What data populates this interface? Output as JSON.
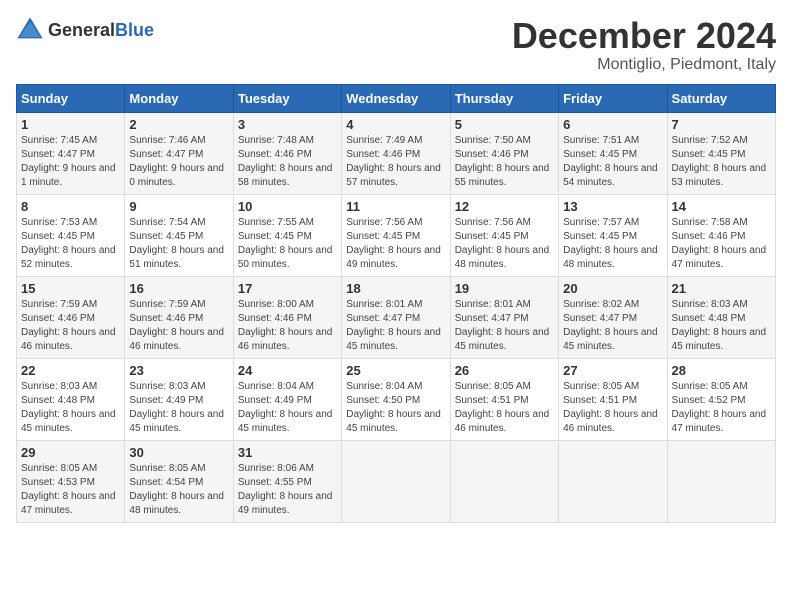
{
  "header": {
    "logo_general": "General",
    "logo_blue": "Blue",
    "month": "December 2024",
    "location": "Montiglio, Piedmont, Italy"
  },
  "days_of_week": [
    "Sunday",
    "Monday",
    "Tuesday",
    "Wednesday",
    "Thursday",
    "Friday",
    "Saturday"
  ],
  "weeks": [
    [
      {
        "day": "1",
        "sunrise": "Sunrise: 7:45 AM",
        "sunset": "Sunset: 4:47 PM",
        "daylight": "Daylight: 9 hours and 1 minute."
      },
      {
        "day": "2",
        "sunrise": "Sunrise: 7:46 AM",
        "sunset": "Sunset: 4:47 PM",
        "daylight": "Daylight: 9 hours and 0 minutes."
      },
      {
        "day": "3",
        "sunrise": "Sunrise: 7:48 AM",
        "sunset": "Sunset: 4:46 PM",
        "daylight": "Daylight: 8 hours and 58 minutes."
      },
      {
        "day": "4",
        "sunrise": "Sunrise: 7:49 AM",
        "sunset": "Sunset: 4:46 PM",
        "daylight": "Daylight: 8 hours and 57 minutes."
      },
      {
        "day": "5",
        "sunrise": "Sunrise: 7:50 AM",
        "sunset": "Sunset: 4:46 PM",
        "daylight": "Daylight: 8 hours and 55 minutes."
      },
      {
        "day": "6",
        "sunrise": "Sunrise: 7:51 AM",
        "sunset": "Sunset: 4:45 PM",
        "daylight": "Daylight: 8 hours and 54 minutes."
      },
      {
        "day": "7",
        "sunrise": "Sunrise: 7:52 AM",
        "sunset": "Sunset: 4:45 PM",
        "daylight": "Daylight: 8 hours and 53 minutes."
      }
    ],
    [
      {
        "day": "8",
        "sunrise": "Sunrise: 7:53 AM",
        "sunset": "Sunset: 4:45 PM",
        "daylight": "Daylight: 8 hours and 52 minutes."
      },
      {
        "day": "9",
        "sunrise": "Sunrise: 7:54 AM",
        "sunset": "Sunset: 4:45 PM",
        "daylight": "Daylight: 8 hours and 51 minutes."
      },
      {
        "day": "10",
        "sunrise": "Sunrise: 7:55 AM",
        "sunset": "Sunset: 4:45 PM",
        "daylight": "Daylight: 8 hours and 50 minutes."
      },
      {
        "day": "11",
        "sunrise": "Sunrise: 7:56 AM",
        "sunset": "Sunset: 4:45 PM",
        "daylight": "Daylight: 8 hours and 49 minutes."
      },
      {
        "day": "12",
        "sunrise": "Sunrise: 7:56 AM",
        "sunset": "Sunset: 4:45 PM",
        "daylight": "Daylight: 8 hours and 48 minutes."
      },
      {
        "day": "13",
        "sunrise": "Sunrise: 7:57 AM",
        "sunset": "Sunset: 4:45 PM",
        "daylight": "Daylight: 8 hours and 48 minutes."
      },
      {
        "day": "14",
        "sunrise": "Sunrise: 7:58 AM",
        "sunset": "Sunset: 4:46 PM",
        "daylight": "Daylight: 8 hours and 47 minutes."
      }
    ],
    [
      {
        "day": "15",
        "sunrise": "Sunrise: 7:59 AM",
        "sunset": "Sunset: 4:46 PM",
        "daylight": "Daylight: 8 hours and 46 minutes."
      },
      {
        "day": "16",
        "sunrise": "Sunrise: 7:59 AM",
        "sunset": "Sunset: 4:46 PM",
        "daylight": "Daylight: 8 hours and 46 minutes."
      },
      {
        "day": "17",
        "sunrise": "Sunrise: 8:00 AM",
        "sunset": "Sunset: 4:46 PM",
        "daylight": "Daylight: 8 hours and 46 minutes."
      },
      {
        "day": "18",
        "sunrise": "Sunrise: 8:01 AM",
        "sunset": "Sunset: 4:47 PM",
        "daylight": "Daylight: 8 hours and 45 minutes."
      },
      {
        "day": "19",
        "sunrise": "Sunrise: 8:01 AM",
        "sunset": "Sunset: 4:47 PM",
        "daylight": "Daylight: 8 hours and 45 minutes."
      },
      {
        "day": "20",
        "sunrise": "Sunrise: 8:02 AM",
        "sunset": "Sunset: 4:47 PM",
        "daylight": "Daylight: 8 hours and 45 minutes."
      },
      {
        "day": "21",
        "sunrise": "Sunrise: 8:03 AM",
        "sunset": "Sunset: 4:48 PM",
        "daylight": "Daylight: 8 hours and 45 minutes."
      }
    ],
    [
      {
        "day": "22",
        "sunrise": "Sunrise: 8:03 AM",
        "sunset": "Sunset: 4:48 PM",
        "daylight": "Daylight: 8 hours and 45 minutes."
      },
      {
        "day": "23",
        "sunrise": "Sunrise: 8:03 AM",
        "sunset": "Sunset: 4:49 PM",
        "daylight": "Daylight: 8 hours and 45 minutes."
      },
      {
        "day": "24",
        "sunrise": "Sunrise: 8:04 AM",
        "sunset": "Sunset: 4:49 PM",
        "daylight": "Daylight: 8 hours and 45 minutes."
      },
      {
        "day": "25",
        "sunrise": "Sunrise: 8:04 AM",
        "sunset": "Sunset: 4:50 PM",
        "daylight": "Daylight: 8 hours and 45 minutes."
      },
      {
        "day": "26",
        "sunrise": "Sunrise: 8:05 AM",
        "sunset": "Sunset: 4:51 PM",
        "daylight": "Daylight: 8 hours and 46 minutes."
      },
      {
        "day": "27",
        "sunrise": "Sunrise: 8:05 AM",
        "sunset": "Sunset: 4:51 PM",
        "daylight": "Daylight: 8 hours and 46 minutes."
      },
      {
        "day": "28",
        "sunrise": "Sunrise: 8:05 AM",
        "sunset": "Sunset: 4:52 PM",
        "daylight": "Daylight: 8 hours and 47 minutes."
      }
    ],
    [
      {
        "day": "29",
        "sunrise": "Sunrise: 8:05 AM",
        "sunset": "Sunset: 4:53 PM",
        "daylight": "Daylight: 8 hours and 47 minutes."
      },
      {
        "day": "30",
        "sunrise": "Sunrise: 8:05 AM",
        "sunset": "Sunset: 4:54 PM",
        "daylight": "Daylight: 8 hours and 48 minutes."
      },
      {
        "day": "31",
        "sunrise": "Sunrise: 8:06 AM",
        "sunset": "Sunset: 4:55 PM",
        "daylight": "Daylight: 8 hours and 49 minutes."
      },
      null,
      null,
      null,
      null
    ]
  ]
}
